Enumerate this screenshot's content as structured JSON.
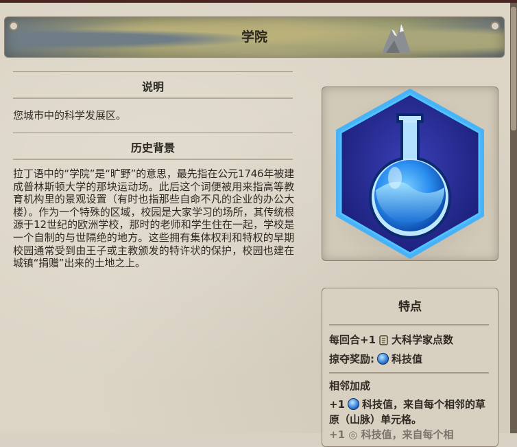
{
  "title": "学院",
  "left": {
    "section_description": "说明",
    "description_text": "您城市中的科学发展区。",
    "section_history": "历史背景",
    "history_text": "拉丁语中的“学院”是“旷野”的意思，最先指在公元1746年被建成普林斯顿大学的那块运动场。此后这个词便被用来指高等教育机构里的景观设置（有时也指那些自命不凡的企业的办公大楼）。作为一个特殊的区域，校园是大家学习的场所，其传统根源于12世纪的欧洲学校，那时的老师和学生住在一起，学校是一个自制的与世隔绝的地方。这些拥有集体权利和特权的早期校园通常受到由王子或主教颁发的特许状的保护，校园也建在城镇“捐赠”出来的土地之上。"
  },
  "icon": {
    "name": "campus-flask-icon",
    "hex_fill": "#2a2f9a",
    "glow": "#3fa3ff"
  },
  "features": {
    "title": "特点",
    "per_turn_prefix": "每回合+1",
    "per_turn_suffix": "大科学家点数",
    "pillage_prefix": "掠夺奖励:",
    "pillage_suffix": "科技值",
    "adjacency_title": "相邻加成",
    "adjacency_prefix": "+1",
    "adjacency_suffix": "科技值，来自每个相邻的草原（山脉）单元格。",
    "cut_line": "+1 ◎ 科技值，来自每个相"
  }
}
